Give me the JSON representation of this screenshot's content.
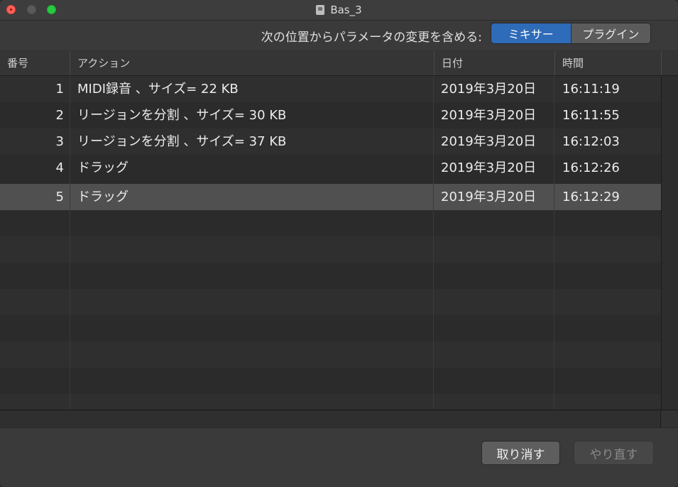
{
  "window": {
    "title": "Bas_3"
  },
  "toolbar": {
    "label": "次の位置からパラメータの変更を含める:",
    "segments": [
      {
        "label": "ミキサー",
        "active": true
      },
      {
        "label": "プラグイン",
        "active": false
      }
    ]
  },
  "table": {
    "columns": [
      "番号",
      "アクション",
      "日付",
      "時間"
    ],
    "rows": [
      {
        "num": "1",
        "action": "MIDI録音 、サイズ= 22 KB",
        "date": "2019年3月20日",
        "time": "16:11:19"
      },
      {
        "num": "2",
        "action": "リージョンを分割 、サイズ= 30 KB",
        "date": "2019年3月20日",
        "time": "16:11:55"
      },
      {
        "num": "3",
        "action": "リージョンを分割 、サイズ= 37 KB",
        "date": "2019年3月20日",
        "time": "16:12:03"
      },
      {
        "num": "4",
        "action": "ドラッグ",
        "date": "2019年3月20日",
        "time": "16:12:26"
      },
      {
        "num": "5",
        "action": "ドラッグ",
        "date": "2019年3月20日",
        "time": "16:12:29"
      }
    ],
    "selected_row": "5"
  },
  "footer": {
    "undo_label": "取り消す",
    "redo_label": "やり直す"
  },
  "colors": {
    "accent": "#2e6bb8",
    "close": "#fe5f57",
    "maximize": "#28c840"
  }
}
